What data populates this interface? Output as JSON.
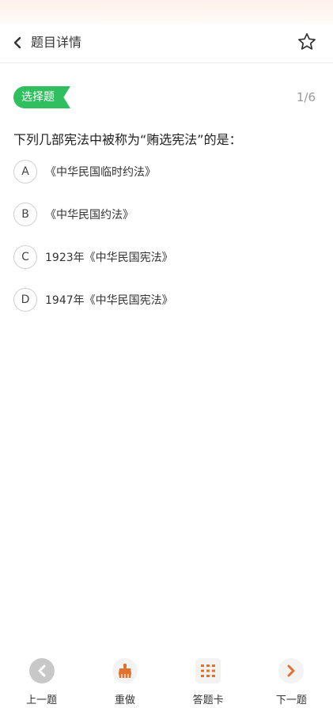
{
  "header": {
    "title": "题目详情",
    "back_icon": "chevron-left-icon",
    "star_icon": "star-outline-icon"
  },
  "question": {
    "type_tag": "选择题",
    "progress": "1/6",
    "text": "下列几部宪法中被称为“贿选宪法”的是：",
    "options": [
      {
        "letter": "A",
        "text": "《中华民国临时约法》"
      },
      {
        "letter": "B",
        "text": "《中华民国约法》"
      },
      {
        "letter": "C",
        "text": "1923年《中华民国宪法》"
      },
      {
        "letter": "D",
        "text": "1947年《中华民国宪法》"
      }
    ]
  },
  "bottom_nav": {
    "prev_label": "上一题",
    "redo_label": "重做",
    "card_label": "答题卡",
    "next_label": "下一题"
  },
  "colors": {
    "tag_green": "#2fbf5f",
    "accent_orange": "#e0722d",
    "disabled_gray": "#c8c8c8"
  }
}
